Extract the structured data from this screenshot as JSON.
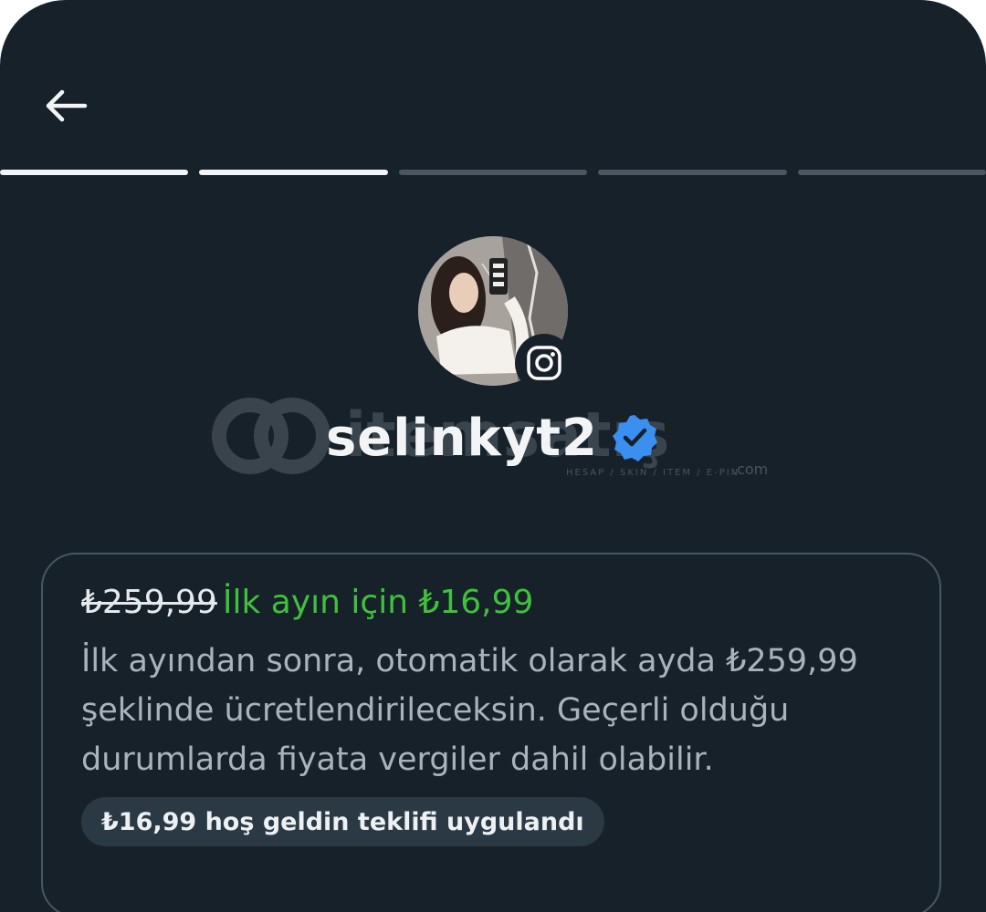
{
  "header": {
    "back_icon": "arrow-left-icon"
  },
  "progress": {
    "total_steps": 5,
    "completed_steps": 2,
    "active_color": "#f2f4f5",
    "inactive_color": "#4a5762"
  },
  "profile": {
    "username": "selinkyt2",
    "verified": true,
    "verified_color": "#3b8ff0",
    "platform_icon": "instagram-icon"
  },
  "watermark": {
    "brand": "itemsatış",
    "tagline": "HESAP / SKIN / ITEM / E-PIN",
    "suffix": ".com"
  },
  "offer": {
    "old_price": "₺259,99",
    "promo": "İlk ayın için ₺16,99",
    "description": "İlk ayından sonra, otomatik olarak ayda ₺259,99 şeklinde ücretlendirileceksin. Geçerli olduğu durumlarda fiyata vergiler dahil olabilir.",
    "applied_badge": "₺16,99 hoş geldin teklifi uygulandı",
    "promo_color": "#3fc13c"
  }
}
